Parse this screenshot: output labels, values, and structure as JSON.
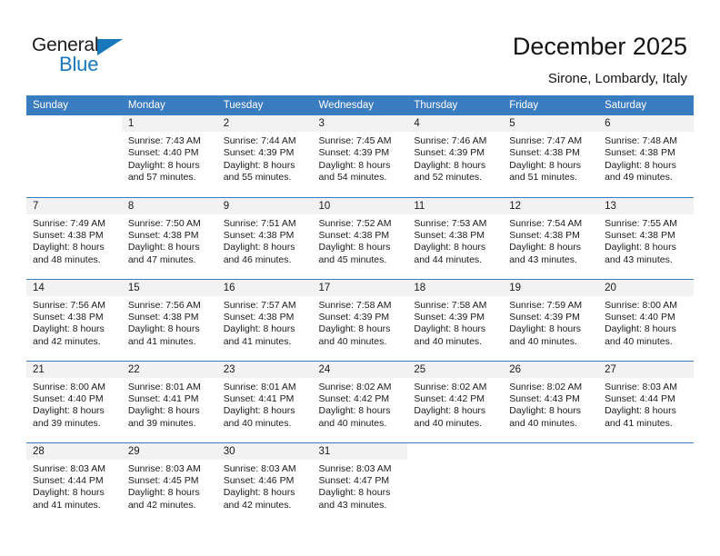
{
  "brand": {
    "name_top": "General",
    "name_bottom": "Blue",
    "accent_color": "#1878be"
  },
  "header": {
    "title": "December 2025",
    "subtitle": "Sirone, Lombardy, Italy"
  },
  "calendar": {
    "header_color": "#3a7cc0",
    "daynum_background": "#f2f2f2",
    "weekdays": [
      "Sunday",
      "Monday",
      "Tuesday",
      "Wednesday",
      "Thursday",
      "Friday",
      "Saturday"
    ],
    "weeks": [
      [
        {
          "day": "",
          "sunrise": "",
          "sunset": "",
          "daylight_line1": "",
          "daylight_line2": ""
        },
        {
          "day": "1",
          "sunrise": "Sunrise: 7:43 AM",
          "sunset": "Sunset: 4:40 PM",
          "daylight_line1": "Daylight: 8 hours",
          "daylight_line2": "and 57 minutes."
        },
        {
          "day": "2",
          "sunrise": "Sunrise: 7:44 AM",
          "sunset": "Sunset: 4:39 PM",
          "daylight_line1": "Daylight: 8 hours",
          "daylight_line2": "and 55 minutes."
        },
        {
          "day": "3",
          "sunrise": "Sunrise: 7:45 AM",
          "sunset": "Sunset: 4:39 PM",
          "daylight_line1": "Daylight: 8 hours",
          "daylight_line2": "and 54 minutes."
        },
        {
          "day": "4",
          "sunrise": "Sunrise: 7:46 AM",
          "sunset": "Sunset: 4:39 PM",
          "daylight_line1": "Daylight: 8 hours",
          "daylight_line2": "and 52 minutes."
        },
        {
          "day": "5",
          "sunrise": "Sunrise: 7:47 AM",
          "sunset": "Sunset: 4:38 PM",
          "daylight_line1": "Daylight: 8 hours",
          "daylight_line2": "and 51 minutes."
        },
        {
          "day": "6",
          "sunrise": "Sunrise: 7:48 AM",
          "sunset": "Sunset: 4:38 PM",
          "daylight_line1": "Daylight: 8 hours",
          "daylight_line2": "and 49 minutes."
        }
      ],
      [
        {
          "day": "7",
          "sunrise": "Sunrise: 7:49 AM",
          "sunset": "Sunset: 4:38 PM",
          "daylight_line1": "Daylight: 8 hours",
          "daylight_line2": "and 48 minutes."
        },
        {
          "day": "8",
          "sunrise": "Sunrise: 7:50 AM",
          "sunset": "Sunset: 4:38 PM",
          "daylight_line1": "Daylight: 8 hours",
          "daylight_line2": "and 47 minutes."
        },
        {
          "day": "9",
          "sunrise": "Sunrise: 7:51 AM",
          "sunset": "Sunset: 4:38 PM",
          "daylight_line1": "Daylight: 8 hours",
          "daylight_line2": "and 46 minutes."
        },
        {
          "day": "10",
          "sunrise": "Sunrise: 7:52 AM",
          "sunset": "Sunset: 4:38 PM",
          "daylight_line1": "Daylight: 8 hours",
          "daylight_line2": "and 45 minutes."
        },
        {
          "day": "11",
          "sunrise": "Sunrise: 7:53 AM",
          "sunset": "Sunset: 4:38 PM",
          "daylight_line1": "Daylight: 8 hours",
          "daylight_line2": "and 44 minutes."
        },
        {
          "day": "12",
          "sunrise": "Sunrise: 7:54 AM",
          "sunset": "Sunset: 4:38 PM",
          "daylight_line1": "Daylight: 8 hours",
          "daylight_line2": "and 43 minutes."
        },
        {
          "day": "13",
          "sunrise": "Sunrise: 7:55 AM",
          "sunset": "Sunset: 4:38 PM",
          "daylight_line1": "Daylight: 8 hours",
          "daylight_line2": "and 43 minutes."
        }
      ],
      [
        {
          "day": "14",
          "sunrise": "Sunrise: 7:56 AM",
          "sunset": "Sunset: 4:38 PM",
          "daylight_line1": "Daylight: 8 hours",
          "daylight_line2": "and 42 minutes."
        },
        {
          "day": "15",
          "sunrise": "Sunrise: 7:56 AM",
          "sunset": "Sunset: 4:38 PM",
          "daylight_line1": "Daylight: 8 hours",
          "daylight_line2": "and 41 minutes."
        },
        {
          "day": "16",
          "sunrise": "Sunrise: 7:57 AM",
          "sunset": "Sunset: 4:38 PM",
          "daylight_line1": "Daylight: 8 hours",
          "daylight_line2": "and 41 minutes."
        },
        {
          "day": "17",
          "sunrise": "Sunrise: 7:58 AM",
          "sunset": "Sunset: 4:39 PM",
          "daylight_line1": "Daylight: 8 hours",
          "daylight_line2": "and 40 minutes."
        },
        {
          "day": "18",
          "sunrise": "Sunrise: 7:58 AM",
          "sunset": "Sunset: 4:39 PM",
          "daylight_line1": "Daylight: 8 hours",
          "daylight_line2": "and 40 minutes."
        },
        {
          "day": "19",
          "sunrise": "Sunrise: 7:59 AM",
          "sunset": "Sunset: 4:39 PM",
          "daylight_line1": "Daylight: 8 hours",
          "daylight_line2": "and 40 minutes."
        },
        {
          "day": "20",
          "sunrise": "Sunrise: 8:00 AM",
          "sunset": "Sunset: 4:40 PM",
          "daylight_line1": "Daylight: 8 hours",
          "daylight_line2": "and 40 minutes."
        }
      ],
      [
        {
          "day": "21",
          "sunrise": "Sunrise: 8:00 AM",
          "sunset": "Sunset: 4:40 PM",
          "daylight_line1": "Daylight: 8 hours",
          "daylight_line2": "and 39 minutes."
        },
        {
          "day": "22",
          "sunrise": "Sunrise: 8:01 AM",
          "sunset": "Sunset: 4:41 PM",
          "daylight_line1": "Daylight: 8 hours",
          "daylight_line2": "and 39 minutes."
        },
        {
          "day": "23",
          "sunrise": "Sunrise: 8:01 AM",
          "sunset": "Sunset: 4:41 PM",
          "daylight_line1": "Daylight: 8 hours",
          "daylight_line2": "and 40 minutes."
        },
        {
          "day": "24",
          "sunrise": "Sunrise: 8:02 AM",
          "sunset": "Sunset: 4:42 PM",
          "daylight_line1": "Daylight: 8 hours",
          "daylight_line2": "and 40 minutes."
        },
        {
          "day": "25",
          "sunrise": "Sunrise: 8:02 AM",
          "sunset": "Sunset: 4:42 PM",
          "daylight_line1": "Daylight: 8 hours",
          "daylight_line2": "and 40 minutes."
        },
        {
          "day": "26",
          "sunrise": "Sunrise: 8:02 AM",
          "sunset": "Sunset: 4:43 PM",
          "daylight_line1": "Daylight: 8 hours",
          "daylight_line2": "and 40 minutes."
        },
        {
          "day": "27",
          "sunrise": "Sunrise: 8:03 AM",
          "sunset": "Sunset: 4:44 PM",
          "daylight_line1": "Daylight: 8 hours",
          "daylight_line2": "and 41 minutes."
        }
      ],
      [
        {
          "day": "28",
          "sunrise": "Sunrise: 8:03 AM",
          "sunset": "Sunset: 4:44 PM",
          "daylight_line1": "Daylight: 8 hours",
          "daylight_line2": "and 41 minutes."
        },
        {
          "day": "29",
          "sunrise": "Sunrise: 8:03 AM",
          "sunset": "Sunset: 4:45 PM",
          "daylight_line1": "Daylight: 8 hours",
          "daylight_line2": "and 42 minutes."
        },
        {
          "day": "30",
          "sunrise": "Sunrise: 8:03 AM",
          "sunset": "Sunset: 4:46 PM",
          "daylight_line1": "Daylight: 8 hours",
          "daylight_line2": "and 42 minutes."
        },
        {
          "day": "31",
          "sunrise": "Sunrise: 8:03 AM",
          "sunset": "Sunset: 4:47 PM",
          "daylight_line1": "Daylight: 8 hours",
          "daylight_line2": "and 43 minutes."
        },
        {
          "day": "",
          "sunrise": "",
          "sunset": "",
          "daylight_line1": "",
          "daylight_line2": ""
        },
        {
          "day": "",
          "sunrise": "",
          "sunset": "",
          "daylight_line1": "",
          "daylight_line2": ""
        },
        {
          "day": "",
          "sunrise": "",
          "sunset": "",
          "daylight_line1": "",
          "daylight_line2": ""
        }
      ]
    ]
  }
}
